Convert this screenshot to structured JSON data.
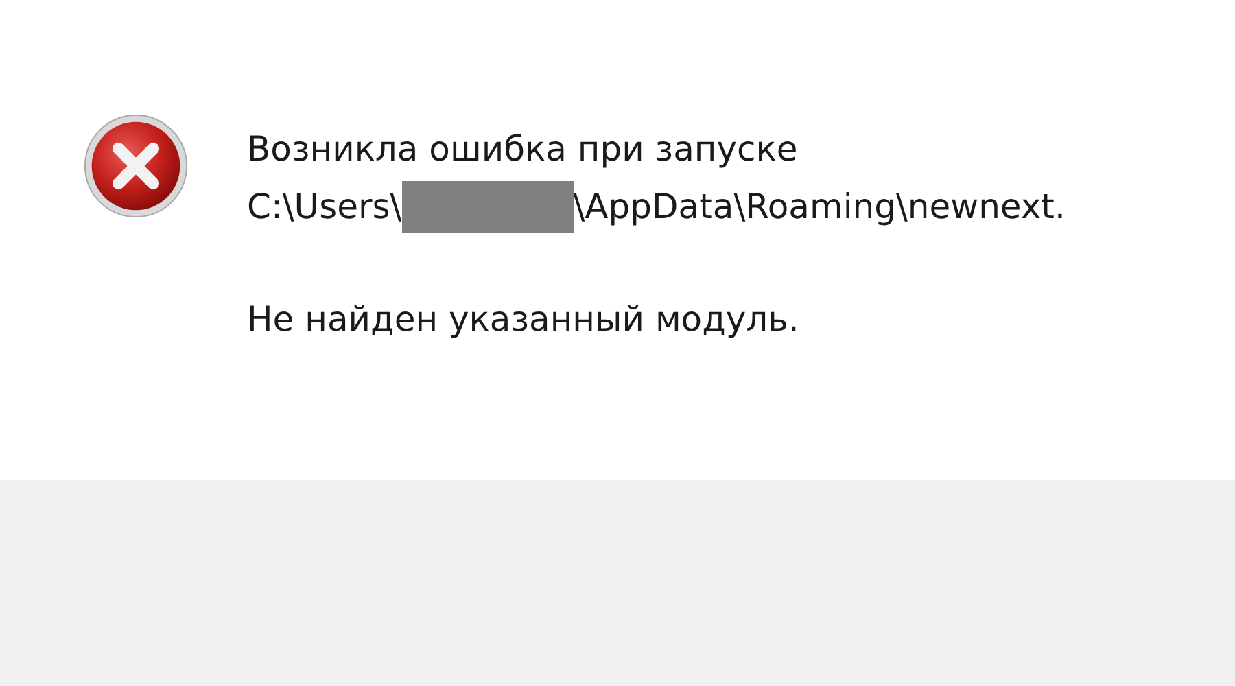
{
  "message": {
    "kind": "error",
    "title": "Возникла ошибка при запуске",
    "path_start": "C:\\Users\\",
    "path_redacted": true,
    "path_end": "\\AppData\\Roaming\\newnext.",
    "detail": "Не найден указанный модуль."
  }
}
